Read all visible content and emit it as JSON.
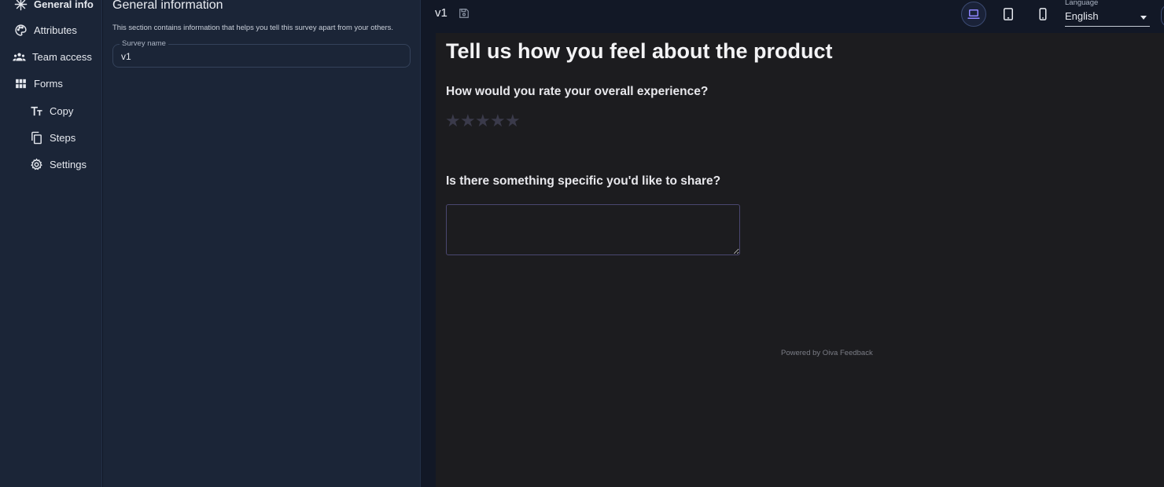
{
  "nav": {
    "items": [
      {
        "label": "General info",
        "icon": "snowflake-icon"
      },
      {
        "label": "Attributes",
        "icon": "palette-icon"
      },
      {
        "label": "Team access",
        "icon": "people-icon"
      },
      {
        "label": "Forms",
        "icon": "grid-icon"
      },
      {
        "label": "Copy",
        "icon": "text-icon"
      },
      {
        "label": "Steps",
        "icon": "copy-pages-icon"
      },
      {
        "label": "Settings",
        "icon": "gear-icon"
      }
    ]
  },
  "panel": {
    "title": "General information",
    "description": "This section contains information that helps you tell this survey apart from your others.",
    "survey_name_label": "Survey name",
    "survey_name_value": "v1"
  },
  "header": {
    "version": "v1",
    "language_label": "Language",
    "language_value": "English",
    "devices": [
      "laptop-icon",
      "tablet-icon",
      "phone-icon"
    ],
    "active_device": "laptop"
  },
  "preview": {
    "title": "Tell us how you feel about the product",
    "question1": "How would you rate your overall experience?",
    "rating_max": 5,
    "rating_value": 0,
    "star_glyph": "★",
    "question2": "Is there something specific you'd like to share?",
    "answer_value": "",
    "powered_by": "Powered by Oiva Feedback"
  },
  "colors": {
    "background": "#121826",
    "sidebar": "#1b2537",
    "preview_bg": "#1c1c1f",
    "accent": "#7d6ad8",
    "star_empty": "#3a3a4a",
    "textarea_border": "#4a4770"
  }
}
